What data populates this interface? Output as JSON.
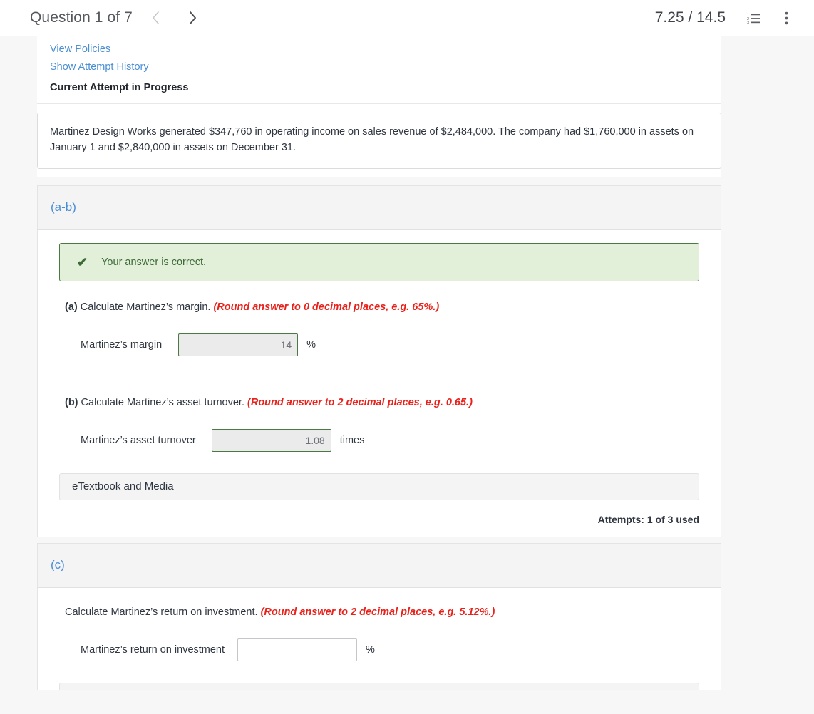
{
  "header": {
    "question_title": "Question 1 of 7",
    "prev_icon": "chevron-left-icon",
    "next_icon": "chevron-right-icon",
    "score": "7.25 / 14.5",
    "list_icon": "numbered-list-icon",
    "more_icon": "more-vertical-icon"
  },
  "links": {
    "view_policies": "View Policies",
    "show_attempt_history": "Show Attempt History",
    "current_attempt": "Current Attempt in Progress"
  },
  "problem": {
    "statement": "Martinez Design Works generated $347,760 in operating income on sales revenue of $2,484,000. The company had $1,760,000 in assets on January 1 and $2,840,000 in assets on December 31."
  },
  "part_ab": {
    "label": "(a-b)",
    "alert": {
      "icon": "check-icon",
      "text": "Your answer is correct."
    },
    "a": {
      "letter": "(a)",
      "prompt": "Calculate Martinez’s margin.",
      "hint": "(Round answer to 0 decimal places, e.g. 65%.)",
      "field_label": "Martinez’s margin",
      "value": "14",
      "placeholder": "",
      "unit": "%"
    },
    "b": {
      "letter": "(b)",
      "prompt": "Calculate Martinez’s asset turnover.",
      "hint": "(Round answer to 2 decimal places, e.g. 0.65.)",
      "field_label": "Martinez’s asset turnover",
      "value": "1.08",
      "placeholder": "",
      "unit": "times"
    },
    "etextbook_label": "eTextbook and Media",
    "attempts": "Attempts: 1 of 3 used"
  },
  "part_c": {
    "label": "(c)",
    "prompt": "Calculate Martinez’s return on investment.",
    "hint": "(Round answer to 2 decimal places, e.g. 5.12%.)",
    "field_label": "Martinez’s return on investment",
    "value": "",
    "placeholder": "",
    "unit": "%"
  },
  "colors": {
    "link_blue": "#4a8fd4",
    "hint_red": "#e8221b",
    "success_green": "#3c6b36",
    "success_bg": "#e2efd9",
    "page_bg": "#f7f7f8"
  }
}
